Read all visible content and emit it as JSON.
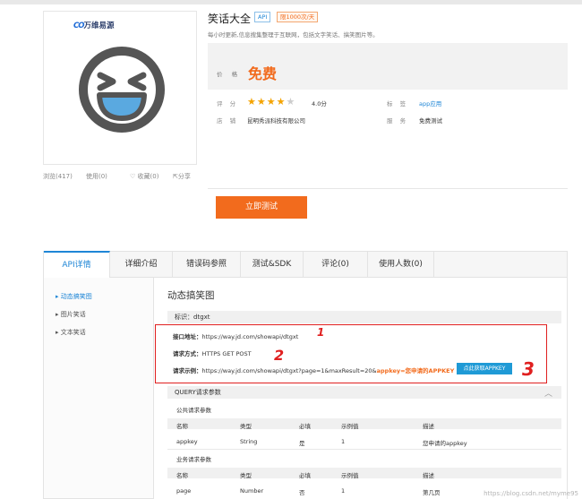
{
  "product": {
    "title": "笑话大全",
    "api_badge": "API",
    "limit_badge": "限1000次/天",
    "desc": "每小时更新,信息搜集整理于互联网，包括文字笑话、搞笑图片等。",
    "brand_prefix": "CO",
    "brand_name": "万维易源",
    "price_label": "价  格",
    "price_value": "免费",
    "rating_label": "评  分",
    "rating_value": 4.0,
    "rating_text": "4.0分",
    "tag_label": "标  签",
    "tag_value": "app应用",
    "shop_label": "店  铺",
    "shop_value": "昆明秀派科技有限公司",
    "service_label": "服  务",
    "service_value": "免费测试",
    "test_button": "立即测试"
  },
  "actions": {
    "views": "浏览(417)",
    "uses": "使用(0)",
    "favorites": "收藏(0)",
    "share": "分享"
  },
  "tabs": [
    "API详情",
    "详细介绍",
    "错误码参照",
    "测试&SDK",
    "评论(0)",
    "使用人数(0)"
  ],
  "sidebar": [
    "动态搞笑图",
    "图片笑话",
    "文本笑话"
  ],
  "detail": {
    "section_title": "动态搞笑图",
    "ident_label": "标识：dtgxt",
    "endpoint_label": "接口地址：",
    "endpoint_value": "https://way.jd.com/showapi/dtgxt",
    "method_label": "请求方式：",
    "method_value": "HTTPS GET POST",
    "example_label": "请求示例：",
    "example_value": "https://way.jd.com/showapi/dtgxt?page=1&maxResult=20&",
    "example_highlight": "appkey=您申请的APPKEY",
    "appkey_button": "点此获取APPKEY",
    "query_title": "QUERY请求参数",
    "public_title": "公共请求参数",
    "business_title": "业务请求参数",
    "columns": [
      "名称",
      "类型",
      "必填",
      "示例值",
      "描述"
    ],
    "public_rows": [
      [
        "appkey",
        "String",
        "是",
        "1",
        "您申请的appkey"
      ]
    ],
    "business_rows": [
      [
        "page",
        "Number",
        "否",
        "1",
        "第几页"
      ]
    ]
  },
  "annotations": [
    "1",
    "2",
    "3"
  ],
  "watermark": "https://blog.csdn.net/myme95",
  "colors": {
    "accent_orange": "#f26b1d",
    "link_blue": "#1f86d6",
    "annotation_red": "#e02020",
    "star_gold": "#f4a300"
  },
  "icons": {
    "favorite": "heart-outline-icon",
    "share": "share-icon",
    "collapse": "chevron-up-icon",
    "sidebar_bullet": "triangle-right-icon"
  }
}
